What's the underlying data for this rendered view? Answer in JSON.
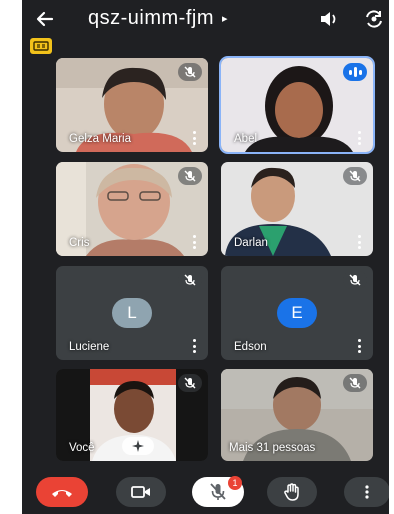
{
  "meeting": {
    "code": "qsz-uimm-fjm",
    "caret": "▸"
  },
  "participants": [
    {
      "name": "Gelza Maria",
      "status": "muted"
    },
    {
      "name": "Abel",
      "status": "speaking"
    },
    {
      "name": "Cris",
      "status": "muted"
    },
    {
      "name": "Darlan",
      "status": "muted"
    },
    {
      "name": "Luciene",
      "initial": "L",
      "avatar_color": "#8fa4b0",
      "status": "muted"
    },
    {
      "name": "Edson",
      "initial": "E",
      "avatar_color": "#1a73e8",
      "status": "muted"
    },
    {
      "name": "Você",
      "status": "muted"
    },
    {
      "name": "Mais 31 pessoas",
      "status": "muted"
    }
  ],
  "controls": {
    "mic_badge": "1"
  },
  "colors": {
    "background": "#1f2023",
    "tile": "#3c4043",
    "end_call": "#ea4335",
    "speaking": "#1a73e8",
    "caption_badge": "#f2c21b"
  },
  "icons": [
    "back-arrow-icon",
    "audio-output-icon",
    "camera-switch-icon",
    "captions-icon",
    "mic-off-icon",
    "more-vert-icon",
    "end-call-icon",
    "camera-icon",
    "raise-hand-icon",
    "effects-icon"
  ]
}
